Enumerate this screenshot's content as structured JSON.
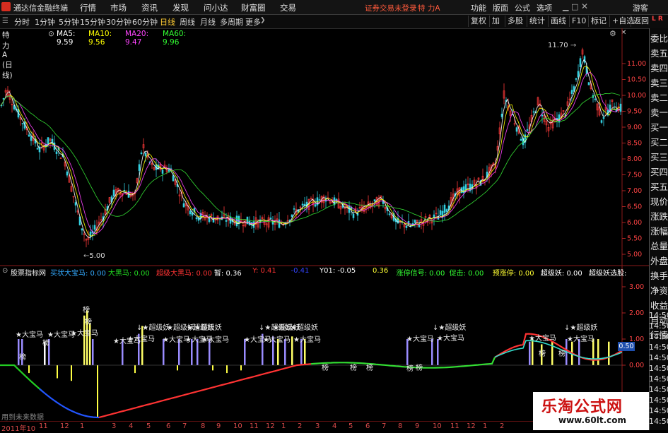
{
  "menubar": {
    "app_title": "通达信金融终端",
    "items": [
      "行情",
      "市场",
      "资讯",
      "发现",
      "问小达",
      "财富圈",
      "交易"
    ],
    "login_status": "证券交易未登录",
    "stock_name": "特 力A",
    "right_items": [
      "功能",
      "版面",
      "公式",
      "选项"
    ],
    "guest": "游客"
  },
  "toolbar": {
    "periods": [
      "分时",
      "1分钟",
      "5分钟",
      "15分钟",
      "30分钟",
      "60分钟",
      "日线",
      "周线",
      "月线",
      "多周期",
      "更多"
    ],
    "active_period": "日线",
    "right_buttons": [
      "复权",
      "加",
      "多股",
      "统计",
      "画线",
      "F10",
      "标记",
      "+自选",
      "返回"
    ]
  },
  "ma_legend": {
    "title": "特 力A (日线)",
    "ma5": "MA5: 9.59",
    "ma10": "MA10: 9.56",
    "ma20": "MA20: 9.47",
    "ma60": "MA60: 9.96",
    "colors": {
      "ma5": "#ffffff",
      "ma10": "#ffff00",
      "ma20": "#ff44ff",
      "ma60": "#33ff33"
    }
  },
  "price_axis": [
    "11.00",
    "10.50",
    "10.00",
    "9.50",
    "9.00",
    "8.50",
    "8.00",
    "7.50",
    "7.00",
    "6.50",
    "6.00",
    "5.50",
    "5.00"
  ],
  "price_annotations": {
    "high": "11.70",
    "low": "5.00"
  },
  "indicator_legend": {
    "name": "股票指标网",
    "items": [
      {
        "label": "买状大宝马: 0.00",
        "color": "#33aaff"
      },
      {
        "label": "大黑马: 0.00",
        "color": "#22dd22"
      },
      {
        "label": "超级大黑马: 0.00",
        "color": "#ff3333"
      },
      {
        "label": "暂: 0.36",
        "color": "#ffffff"
      },
      {
        "label": "Y: 0.41",
        "color": "#ff3333"
      },
      {
        "label": "-0.41",
        "color": "#3344ff"
      },
      {
        "label": "Y01: -0.05",
        "color": "#ffffff"
      },
      {
        "label": "0.36",
        "color": "#ffff33"
      },
      {
        "label": "涨停信号: 0.00",
        "color": "#33ff33"
      },
      {
        "label": "促击: 0.00",
        "color": "#33ff33"
      },
      {
        "label": "预涨停: 0.00",
        "color": "#ffff33"
      },
      {
        "label": "超级妖: 0.00",
        "color": "#ffffff"
      },
      {
        "label": "超级妖选股:",
        "color": "#ffffff"
      }
    ]
  },
  "indicator_axis": [
    "3.00",
    "2.00",
    "1.00",
    "0.00"
  ],
  "indicator_value_box": "0.50",
  "signal_labels": {
    "dbm": "大宝马",
    "cjy": "超级妖",
    "bang": "榜",
    "star": "★",
    "arrow": "↓"
  },
  "status_text": "用到未来数据",
  "right_panel": [
    "委比",
    "卖五",
    "卖四",
    "卖三",
    "卖二",
    "卖一",
    "买一",
    "买二",
    "买三",
    "买四",
    "买五",
    "现价",
    "涨跌",
    "涨幅",
    "总量",
    "外盘",
    "换手",
    "净资",
    "收益",
    "自动",
    "行情"
  ],
  "time_axis": [
    "2011年10",
    "11",
    "12",
    "1",
    "3",
    "4",
    "5",
    "6",
    "7",
    "8",
    "9",
    "10",
    "11",
    "12",
    "1",
    "2",
    "3",
    "4",
    "5",
    "6",
    "7",
    "8",
    "9",
    "10",
    "11",
    "12",
    "1",
    "2"
  ],
  "time_right": [
    "14:50",
    "14:50",
    "14:50",
    "14:50",
    "14:50",
    "14:50",
    "14:50",
    "14:50",
    "14:50",
    "14:50",
    "14:50"
  ],
  "watermark": {
    "title": "乐淘公式网",
    "url": "www.60lt.com"
  },
  "corner_flag": "L R"
}
